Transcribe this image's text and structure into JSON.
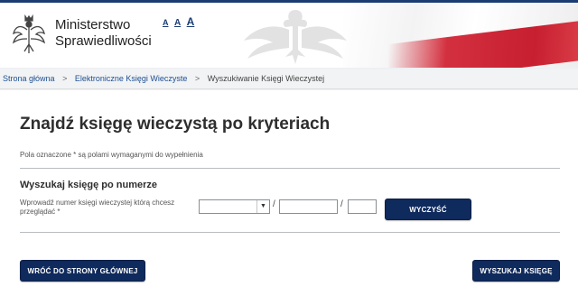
{
  "header": {
    "org_line1": "Ministerstwo",
    "org_line2": "Sprawiedliwości",
    "font_sizes": [
      "A",
      "A",
      "A"
    ]
  },
  "breadcrumb": {
    "items": [
      "Strona główna",
      "Elektroniczne Księgi Wieczyste",
      "Wyszukiwanie Księgi Wieczystej"
    ],
    "separator": ">"
  },
  "main": {
    "title": "Znajdź księgę wieczystą po kryteriach",
    "required_note": "Pola oznaczone * są polami wymaganymi do wypełnienia",
    "section_title": "Wyszukaj księgę po numerze",
    "field_label": "Wprowadź numer księgi wieczystej którą chcesz przeglądać *",
    "court_code_value": "",
    "number_value": "",
    "control_digit_value": "",
    "slash": "/",
    "clear_button": "WYCZYŚĆ",
    "home_button": "WRÓĆ DO STRONY GŁÓWNEJ",
    "search_button": "WYSZUKAJ KSIĘGĘ"
  },
  "colors": {
    "brand_navy": "#0f2a5c",
    "link_blue": "#1d4f91",
    "flag_red": "#d3303f"
  },
  "icons": {
    "emblem": "polish-eagle-emblem",
    "select_arrow": "caret-down-icon"
  }
}
